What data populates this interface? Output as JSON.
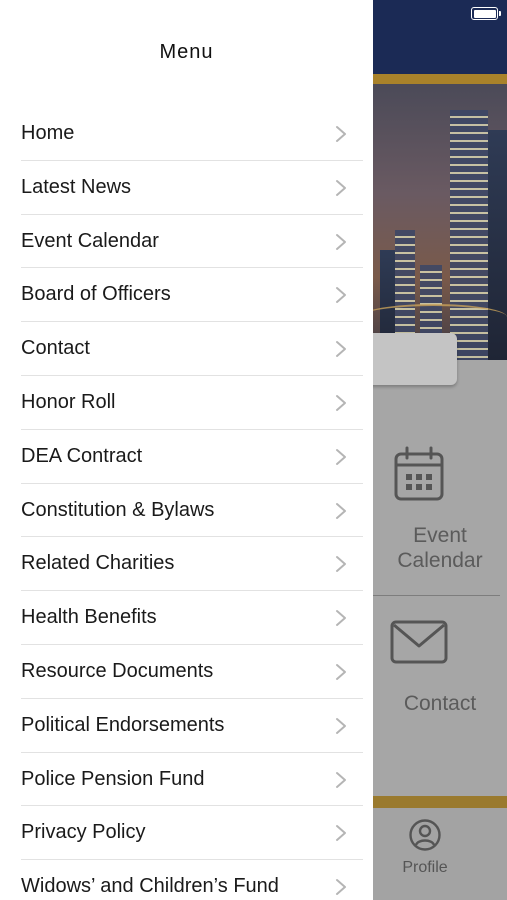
{
  "drawer": {
    "title": "Menu",
    "items": [
      {
        "label": "Home"
      },
      {
        "label": "Latest News"
      },
      {
        "label": "Event Calendar"
      },
      {
        "label": "Board of Officers"
      },
      {
        "label": "Contact"
      },
      {
        "label": "Honor Roll"
      },
      {
        "label": "DEA Contract"
      },
      {
        "label": "Constitution & Bylaws"
      },
      {
        "label": "Related Charities"
      },
      {
        "label": "Health Benefits"
      },
      {
        "label": "Resource Documents"
      },
      {
        "label": "Political Endorsements"
      },
      {
        "label": "Police Pension Fund"
      },
      {
        "label": "Privacy Policy"
      },
      {
        "label": "Widows’ and Children’s Fund"
      }
    ],
    "chevron_icon": "chevron-right-icon"
  },
  "background": {
    "tiles": [
      {
        "label_line1": "Event",
        "label_line2": "Calendar",
        "icon": "calendar-icon"
      },
      {
        "label": "Contact",
        "icon": "envelope-icon"
      }
    ],
    "tabbar": {
      "profile_label": "Profile",
      "profile_icon": "user-circle-icon"
    }
  },
  "colors": {
    "header_navy": "#1b2a55",
    "accent_gold": "#a9822a",
    "overlay_gray": "#a6a6a6",
    "drawer_bg": "#ffffff"
  }
}
